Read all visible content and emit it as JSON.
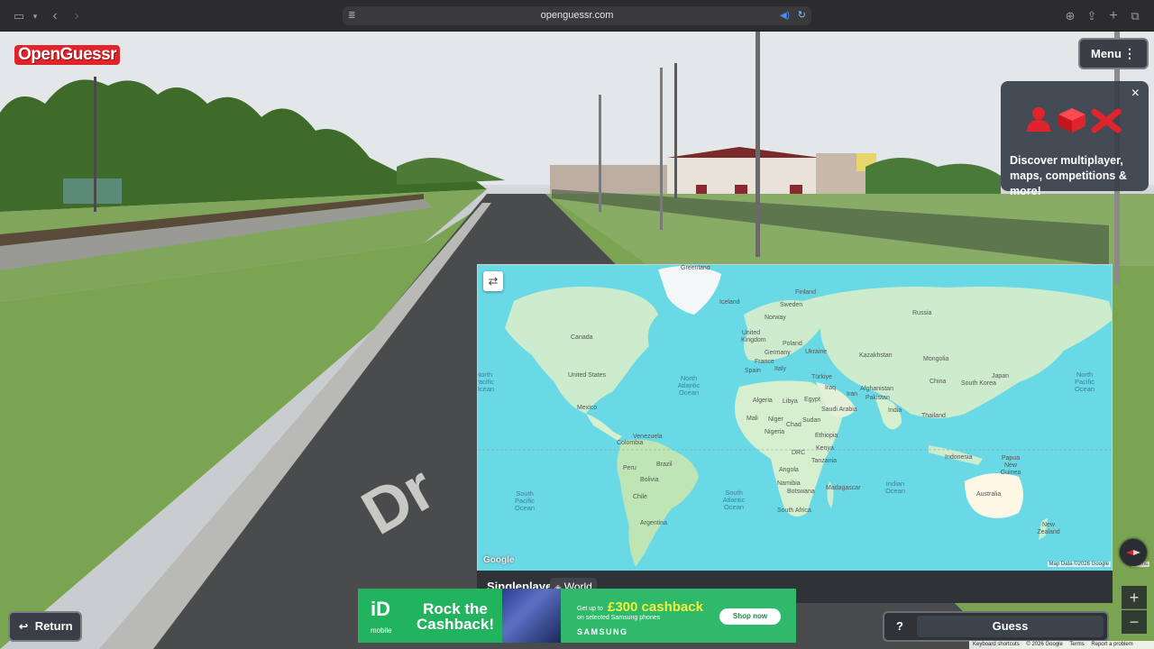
{
  "browser": {
    "url": "openguessr.com",
    "icons": [
      "sidebar-icon",
      "chevron-down-icon",
      "back-icon",
      "forward-icon",
      "reader-icon",
      "audio-icon",
      "reload-icon",
      "download-icon",
      "share-icon",
      "new-tab-icon",
      "tabs-overview-icon"
    ]
  },
  "app": {
    "logo": "OpenGuessr",
    "menu_label": "Menu"
  },
  "promo": {
    "text": "Discover multiplayer, maps, competitions & more!",
    "close_label": "×"
  },
  "map": {
    "mode": "Singleplayer",
    "map_name": "World",
    "attribution": "Map Data ©2026 Google",
    "terms": "Terms",
    "google_logo": "Google",
    "labels": {
      "greenland": "Greenland",
      "canada": "Canada",
      "united_states": "United States",
      "mexico": "Mexico",
      "venezuela": "Venezuela",
      "colombia": "Colombia",
      "peru": "Peru",
      "brazil": "Brazil",
      "bolivia": "Bolivia",
      "chile": "Chile",
      "argentina": "Argentina",
      "iceland": "Iceland",
      "norway": "Norway",
      "sweden": "Sweden",
      "finland": "Finland",
      "united_kingdom": "United Kingdom",
      "germany": "Germany",
      "poland": "Poland",
      "france": "France",
      "ukraine": "Ukraine",
      "spain": "Spain",
      "italy": "Italy",
      "turkiye": "Türkiye",
      "russia": "Russia",
      "kazakhstan": "Kazakhstan",
      "mongolia": "Mongolia",
      "china": "China",
      "south_korea": "South Korea",
      "japan": "Japan",
      "iran": "Iran",
      "iraq": "Iraq",
      "afghanistan": "Afghanistan",
      "pakistan": "Pakistan",
      "india": "India",
      "saudi_arabia": "Saudi Arabia",
      "thailand": "Thailand",
      "algeria": "Algeria",
      "libya": "Libya",
      "egypt": "Egypt",
      "mali": "Mali",
      "niger": "Niger",
      "chad": "Chad",
      "sudan": "Sudan",
      "nigeria": "Nigeria",
      "ethiopia": "Ethiopia",
      "kenya": "Kenya",
      "drc": "DRC",
      "tanzania": "Tanzania",
      "angola": "Angola",
      "namibia": "Namibia",
      "botswana": "Botswana",
      "south_africa": "South Africa",
      "madagascar": "Madagascar",
      "indonesia": "Indonesia",
      "papua_new_guinea": "Papua New Guinea",
      "australia": "Australia",
      "new_zealand": "New Zealand",
      "north_pacific_ocean_left": "North Pacific Ocean",
      "north_pacific_ocean_right": "North Pacific Ocean",
      "north_atlantic_ocean": "North Atlantic Ocean",
      "south_pacific_ocean": "South Pacific Ocean",
      "south_atlantic_ocean": "South Atlantic Ocean",
      "indian_ocean": "Indian Ocean"
    }
  },
  "controls": {
    "return_label": "Return",
    "help_label": "?",
    "guess_label": "Guess"
  },
  "street": {
    "road_marking": "Dr"
  },
  "ad": {
    "logo": "iD",
    "logo_sub": "mobile",
    "headline": "Rock the Cashback!",
    "get_up_to": "Get up to",
    "cashback": "£300 cashback",
    "subline": "on selected Samsung phones",
    "brand": "SAMSUNG",
    "cta": "Shop now"
  },
  "footer": {
    "shortcuts": "Keyboard shortcuts",
    "copyright": "© 2026 Google",
    "terms": "Terms",
    "report": "Report a problem"
  },
  "colors": {
    "brand_red": "#e0242b",
    "ocean": "#6ad9e6",
    "land": "#cdeccd",
    "ad_green": "#2fb96a",
    "ad_yellow": "#f4ef3a"
  }
}
